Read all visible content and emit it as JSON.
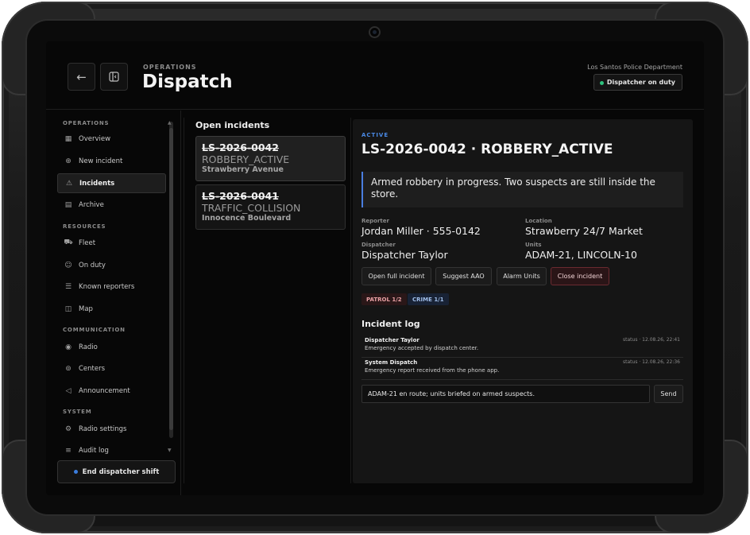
{
  "header": {
    "section": "OPERATIONS",
    "title": "Dispatch",
    "department": "Los Santos Police Department",
    "duty_badge": "Dispatcher on duty"
  },
  "icons": {
    "back": "arrow-left-icon",
    "sidebar_toggle": "sidebar-panel-icon"
  },
  "sidebar": {
    "sections": {
      "operations": "OPERATIONS",
      "resources": "RESOURCES",
      "communication": "COMMUNICATION",
      "system": "SYSTEM"
    },
    "items": [
      {
        "label": "Overview",
        "icon": "grid-icon"
      },
      {
        "label": "New incident",
        "icon": "plus-doc-icon"
      },
      {
        "label": "Incidents",
        "icon": "alarm-icon",
        "active": true
      },
      {
        "label": "Archive",
        "icon": "archive-icon"
      },
      {
        "label": "Fleet",
        "icon": "car-icon"
      },
      {
        "label": "On duty",
        "icon": "users-icon"
      },
      {
        "label": "Known reporters",
        "icon": "contacts-icon"
      },
      {
        "label": "Map",
        "icon": "map-icon"
      },
      {
        "label": "Radio",
        "icon": "radio-icon"
      },
      {
        "label": "Centers",
        "icon": "broadcast-icon"
      },
      {
        "label": "Announcement",
        "icon": "megaphone-icon"
      },
      {
        "label": "Radio settings",
        "icon": "sliders-icon"
      },
      {
        "label": "Audit log",
        "icon": "log-icon"
      }
    ],
    "end_shift": "End dispatcher shift"
  },
  "incidents": {
    "title": "Open incidents",
    "list": [
      {
        "id": "LS-2026-0042",
        "type": "ROBBERY_ACTIVE",
        "location": "Strawberry Avenue",
        "selected": true
      },
      {
        "id": "LS-2026-0041",
        "type": "TRAFFIC_COLLISION",
        "location": "Innocence Boulevard",
        "selected": false
      }
    ]
  },
  "detail": {
    "status": "ACTIVE",
    "title": "LS-2026-0042 · ROBBERY_ACTIVE",
    "description": "Armed robbery in progress. Two suspects are still inside the store.",
    "fields": {
      "reporter_label": "Reporter",
      "reporter": "Jordan Miller · 555-0142",
      "location_label": "Location",
      "location": "Strawberry 24/7 Market",
      "dispatcher_label": "Dispatcher",
      "dispatcher": "Dispatcher Taylor",
      "units_label": "Units",
      "units": "ADAM-21, LINCOLN-10"
    },
    "actions": {
      "open_full": "Open full incident",
      "suggest_aao": "Suggest AAO",
      "alarm_units": "Alarm Units",
      "close": "Close incident"
    },
    "tags": {
      "patrol": "PATROL 1/2",
      "crime": "CRIME 1/1"
    },
    "log_title": "Incident log",
    "log": [
      {
        "who": "Dispatcher Taylor",
        "text": "Emergency accepted by dispatch center.",
        "meta": "status · 12.08.26, 22:41"
      },
      {
        "who": "System Dispatch",
        "text": "Emergency report received from the phone app.",
        "meta": "status · 12.08.26, 22:36"
      }
    ],
    "note_value": "ADAM-21 en route; units briefed on armed suspects.",
    "send": "Send"
  },
  "colors": {
    "accent_blue": "#4a8ae6",
    "duty_green": "#2ec27e",
    "danger": "#6b2a30"
  }
}
